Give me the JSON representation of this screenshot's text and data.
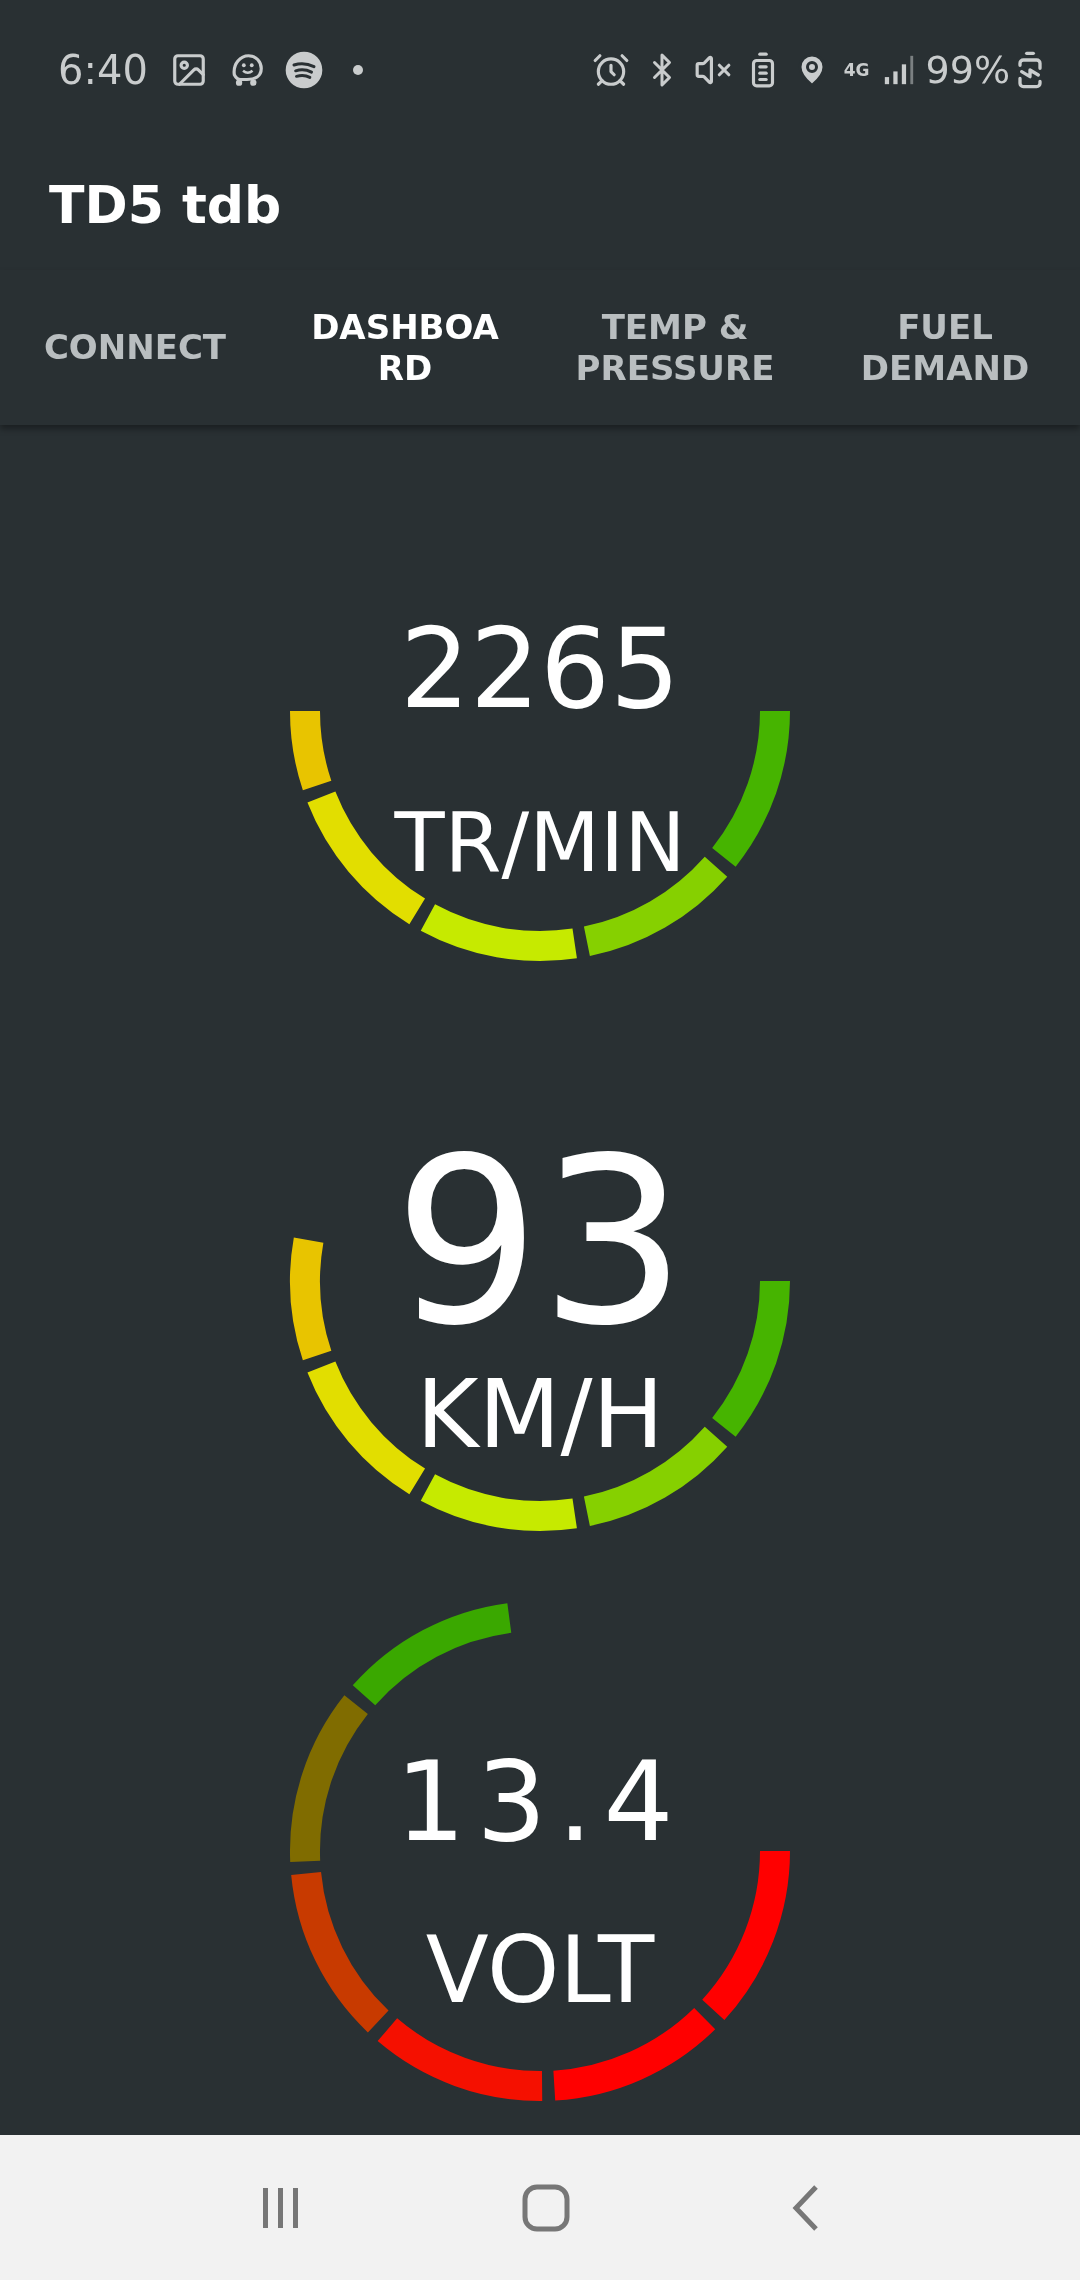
{
  "status_bar": {
    "time": "6:40",
    "network": "4G",
    "battery": "99%"
  },
  "app_bar": {
    "title": "TD5 tdb"
  },
  "tabs": [
    {
      "label": "CONNECT",
      "selected": false
    },
    {
      "label": "DASHBOA\nRD",
      "selected": true
    },
    {
      "label": "TEMP &\nPRESSURE",
      "selected": false
    },
    {
      "label": "FUEL\nDEMAND",
      "selected": false
    }
  ],
  "gauges": [
    {
      "value": "2265",
      "unit": "TR/MIN",
      "segments": [
        {
          "color": "#46b400"
        },
        {
          "color": "#86d000"
        },
        {
          "color": "#c6ea00"
        },
        {
          "color": "#e2de00"
        },
        {
          "color": "#e8c400"
        }
      ]
    },
    {
      "value": "93",
      "unit": "KM/H",
      "segments": [
        {
          "color": "#46b400"
        },
        {
          "color": "#86d000"
        },
        {
          "color": "#c6ea00"
        },
        {
          "color": "#e2de00"
        },
        {
          "color": "#e8c400"
        }
      ]
    },
    {
      "value": "13.4",
      "unit": "VOLT",
      "segments": [
        {
          "color": "#ff0000"
        },
        {
          "color": "#ff0000"
        },
        {
          "color": "#f51000"
        },
        {
          "color": "#c83a00"
        },
        {
          "color": "#806c00"
        },
        {
          "color": "#3aa800"
        }
      ]
    }
  ]
}
